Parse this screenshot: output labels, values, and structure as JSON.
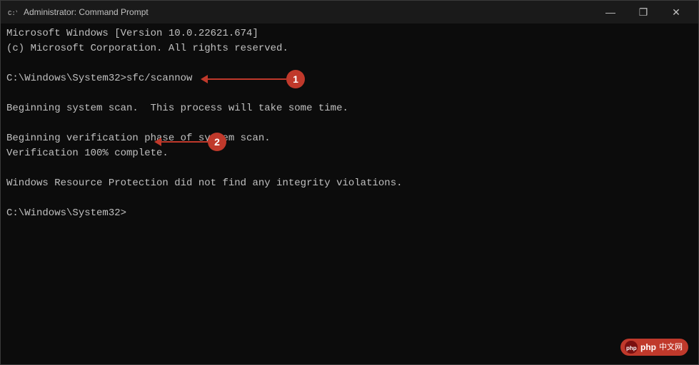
{
  "window": {
    "title": "Administrator: Command Prompt",
    "icon": "cmd-icon"
  },
  "controls": {
    "minimize": "—",
    "maximize": "❐",
    "close": "✕"
  },
  "console": {
    "lines": [
      "Microsoft Windows [Version 10.0.22621.674]",
      "(c) Microsoft Corporation. All rights reserved.",
      "",
      "C:\\Windows\\System32>sfc/scannow",
      "",
      "Beginning system scan.  This process will take some time.",
      "",
      "Beginning verification phase of system scan.",
      "Verification 100% complete.",
      "",
      "Windows Resource Protection did not find any integrity violations.",
      "",
      "C:\\Windows\\System32>"
    ]
  },
  "annotations": [
    {
      "id": "1",
      "label": "1",
      "description": "sfc/scannow command annotation"
    },
    {
      "id": "2",
      "label": "2",
      "description": "Verification complete annotation"
    }
  ],
  "watermark": {
    "text1": "php",
    "text2": "中文网"
  }
}
